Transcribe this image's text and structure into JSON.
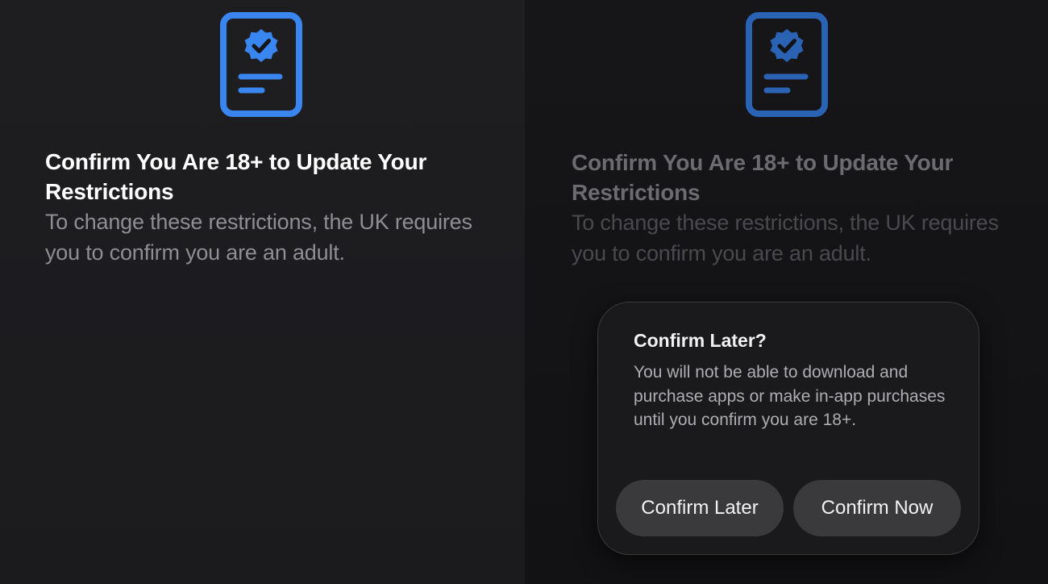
{
  "left_screen": {
    "icon": "verified-document-icon",
    "title": "Confirm You Are 18+ to Update Your Restrictions",
    "description": "To change these restrictions, the UK requires you to confirm you are an adult."
  },
  "right_screen": {
    "icon": "verified-document-icon",
    "title": "Confirm You Are 18+ to Update Your Restrictions",
    "description": "To change these restrictions, the UK requires you to confirm you are an adult."
  },
  "dialog": {
    "title": "Confirm Later?",
    "body": "You will not be able to download and purchase apps or make in-app purchases until you confirm you are 18+.",
    "confirm_later_label": "Confirm Later",
    "confirm_now_label": "Confirm Now"
  },
  "colors": {
    "accent": "#3a86f0",
    "accent_dimmed": "#2a62b4",
    "background": "#1c1c1e",
    "button_fill": "#3a3a3c"
  }
}
